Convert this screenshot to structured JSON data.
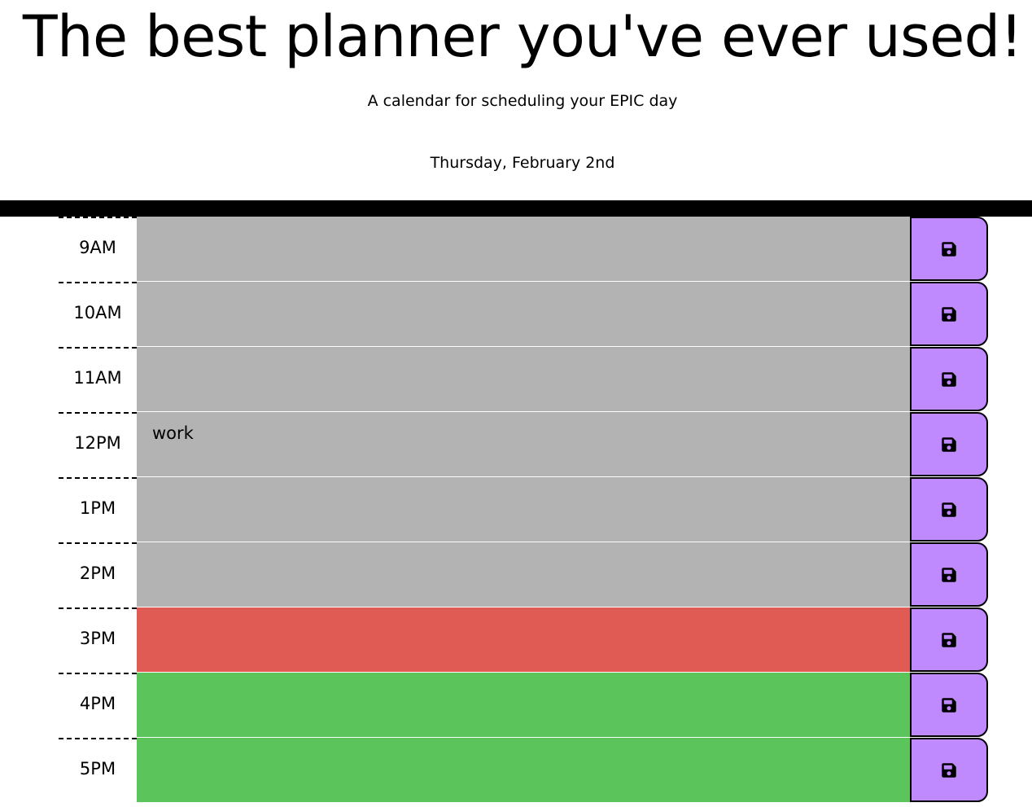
{
  "header": {
    "title": "The best planner you've ever used!",
    "subtitle": "A calendar for scheduling your EPIC day",
    "current_day": "Thursday, February 2nd"
  },
  "colors": {
    "past": "#b3b3b3",
    "present": "#df5b54",
    "future": "#5bc55c",
    "save_button": "#c08aff"
  },
  "time_blocks": [
    {
      "hour": "9AM",
      "text": "",
      "status": "past",
      "icon": "floppy-disk-icon"
    },
    {
      "hour": "10AM",
      "text": "",
      "status": "past",
      "icon": "floppy-disk-icon"
    },
    {
      "hour": "11AM",
      "text": "",
      "status": "past",
      "icon": "floppy-disk-icon"
    },
    {
      "hour": "12PM",
      "text": "work",
      "status": "past",
      "icon": "floppy-disk-icon"
    },
    {
      "hour": "1PM",
      "text": "",
      "status": "past",
      "icon": "floppy-disk-icon"
    },
    {
      "hour": "2PM",
      "text": "",
      "status": "past",
      "icon": "floppy-disk-icon"
    },
    {
      "hour": "3PM",
      "text": "",
      "status": "present",
      "icon": "floppy-disk-icon"
    },
    {
      "hour": "4PM",
      "text": "",
      "status": "future",
      "icon": "floppy-disk-icon"
    },
    {
      "hour": "5PM",
      "text": "",
      "status": "future",
      "icon": "floppy-disk-icon"
    }
  ]
}
